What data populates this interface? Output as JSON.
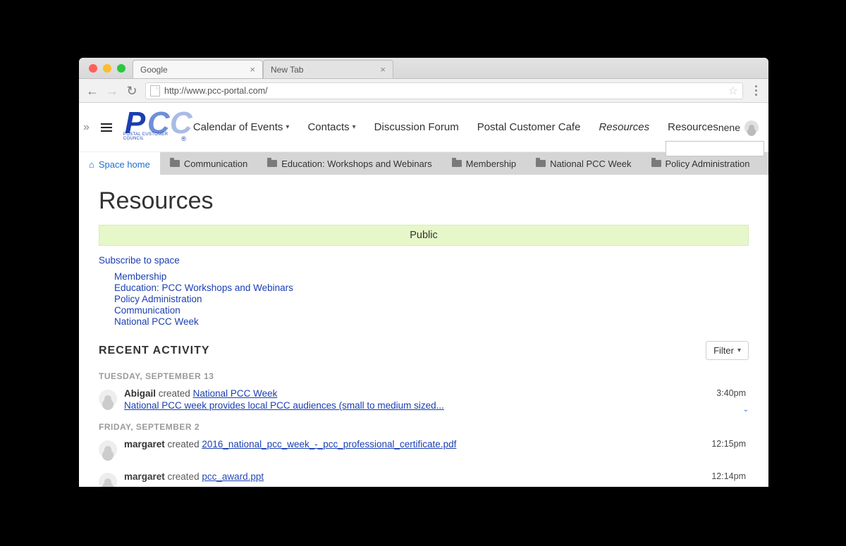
{
  "browser": {
    "tabs": [
      {
        "title": "Google",
        "active": true
      },
      {
        "title": "New Tab",
        "active": false
      }
    ],
    "url": "http://www.pcc-portal.com/"
  },
  "header": {
    "logo_sub": "POSTAL CUSTOMER COUNCIL",
    "nav": [
      {
        "label": "Calendar of Events",
        "caret": true
      },
      {
        "label": "Contacts",
        "caret": true
      },
      {
        "label": "Discussion Forum",
        "caret": false
      },
      {
        "label": "Postal Customer Cafe",
        "caret": false
      },
      {
        "label": "Resources",
        "caret": false,
        "italic": true
      },
      {
        "label": "Resources",
        "caret": false
      }
    ],
    "user": "nene"
  },
  "subnav": [
    {
      "label": "Space home",
      "home": true,
      "active": true
    },
    {
      "label": "Communication"
    },
    {
      "label": "Education: Workshops and Webinars"
    },
    {
      "label": "Membership"
    },
    {
      "label": "National PCC Week"
    },
    {
      "label": "Policy Administration"
    }
  ],
  "page": {
    "title": "Resources",
    "banner": "Public",
    "subscribe": "Subscribe to space",
    "sublinks": [
      "Membership",
      "Education: PCC Workshops and Webinars",
      "Policy Administration",
      "Communication",
      "National PCC Week"
    ],
    "recent_heading": "RECENT ACTIVITY",
    "filter_label": "Filter",
    "days": [
      {
        "label": "TUESDAY, SEPTEMBER 13",
        "items": [
          {
            "who": "Abigail",
            "verb": "created",
            "what": "National PCC Week",
            "desc": "National PCC week provides local PCC audiences (small to medium sized...",
            "time": "3:40pm",
            "expand": true
          }
        ]
      },
      {
        "label": "FRIDAY, SEPTEMBER 2",
        "items": [
          {
            "who": "margaret",
            "verb": "created",
            "what": "2016_national_pcc_week_-_pcc_professional_certificate.pdf",
            "time": "12:15pm"
          },
          {
            "who": "margaret",
            "verb": "created",
            "what": "pcc_award.ppt",
            "time": "12:14pm",
            "cut": true
          }
        ]
      }
    ]
  }
}
